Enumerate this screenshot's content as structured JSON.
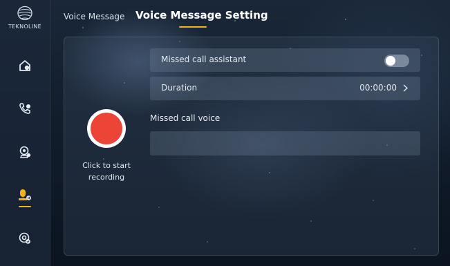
{
  "brand": {
    "name": "TEKNOLINE",
    "icon": "brand-logo-icon"
  },
  "sidebar": {
    "items": [
      {
        "name": "home",
        "icon": "home-icon",
        "active": false
      },
      {
        "name": "call",
        "icon": "phone-icon",
        "active": false
      },
      {
        "name": "monitor",
        "icon": "camera-icon",
        "active": false
      },
      {
        "name": "voice-message",
        "icon": "voicemail-icon",
        "active": true
      },
      {
        "name": "settings",
        "icon": "settings-icon",
        "active": false
      }
    ]
  },
  "header": {
    "tabs": [
      {
        "label": "Voice Message",
        "active": false
      },
      {
        "label": "Voice Message Setting",
        "active": true
      }
    ]
  },
  "recorder": {
    "label": "Click to start recording"
  },
  "settings": {
    "missed_call_assistant": {
      "label": "Missed call assistant",
      "enabled": false
    },
    "duration": {
      "label": "Duration",
      "value": "00:00:00"
    },
    "missed_call_voice": {
      "label": "Missed call voice",
      "value": ""
    }
  },
  "colors": {
    "accent": "#f3b41b",
    "record": "#ec4437"
  }
}
